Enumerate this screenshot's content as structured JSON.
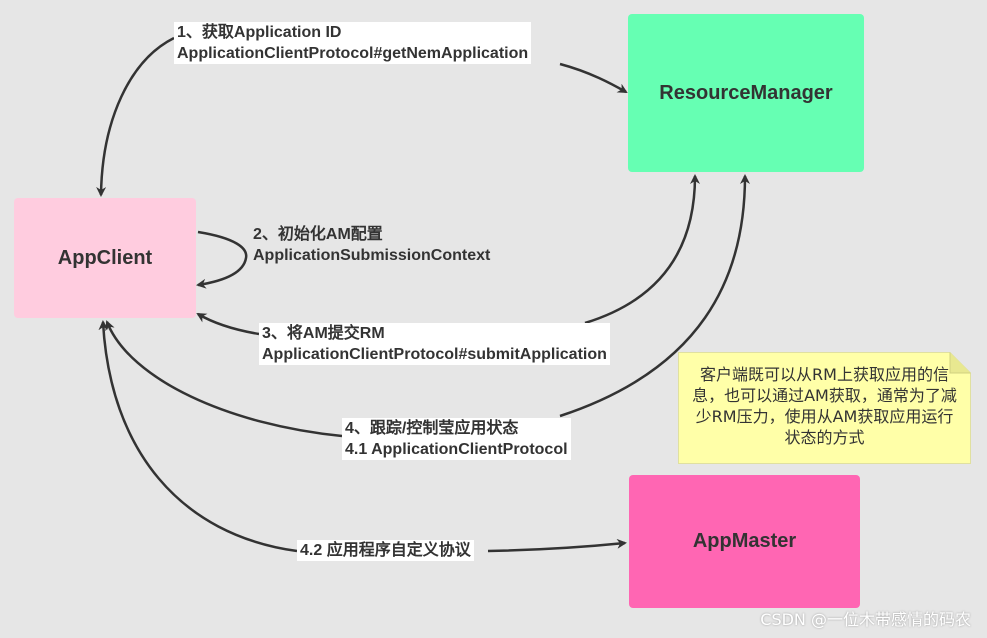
{
  "nodes": {
    "resource_manager": "ResourceManager",
    "app_client": "AppClient",
    "app_master": "AppMaster"
  },
  "edges": {
    "get_app_id": {
      "line1": "1、获取Application ID",
      "line2": "ApplicationClientProtocol#getNemApplication"
    },
    "init_am": {
      "line1": "2、初始化AM配置",
      "line2": "ApplicationSubmissionContext"
    },
    "submit_am": {
      "line1": "3、将AM提交RM",
      "line2": "ApplicationClientProtocol#submitApplication"
    },
    "track_status": {
      "line1": "4、跟踪/控制莹应用状态",
      "line2": "4.1 ApplicationClientProtocol"
    },
    "custom_protocol": {
      "line1": "4.2 应用程序自定义协议"
    }
  },
  "note": {
    "text": "客户端既可以从RM上获取应用的信息，也可以通过AM获取，通常为了减少RM压力，使用从AM获取应用运行状态的方式"
  },
  "watermark": "CSDN @一位木带感情的码农",
  "colors": {
    "background": "#e6e6e6",
    "resource_manager": "#66ffb3",
    "app_client": "#ffccdf",
    "app_master": "#ff66b3",
    "note": "#ffffa8",
    "arrow": "#333333"
  }
}
